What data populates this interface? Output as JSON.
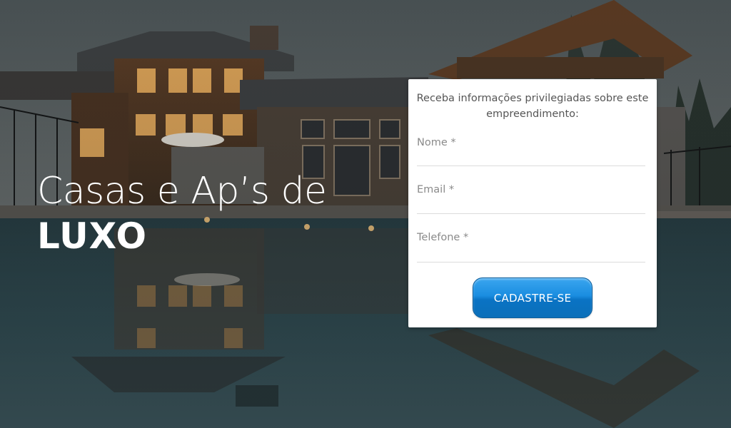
{
  "hero": {
    "title_line1": "Casas e Ap’s de",
    "title_line2": "LUXO"
  },
  "form": {
    "heading": "Receba informações privilegiadas sobre este empreendimento:",
    "fields": {
      "name_placeholder": "Nome *",
      "email_placeholder": "Email *",
      "phone_placeholder": "Telefone *"
    },
    "submit_label": "CADASTRE-SE"
  },
  "colors": {
    "button_blue": "#1a8de0",
    "card_bg": "#ffffff",
    "hero_text": "#ffffff"
  },
  "background": {
    "image_subject": "luxury-lodge-house-with-reflecting-pool-at-dusk"
  }
}
